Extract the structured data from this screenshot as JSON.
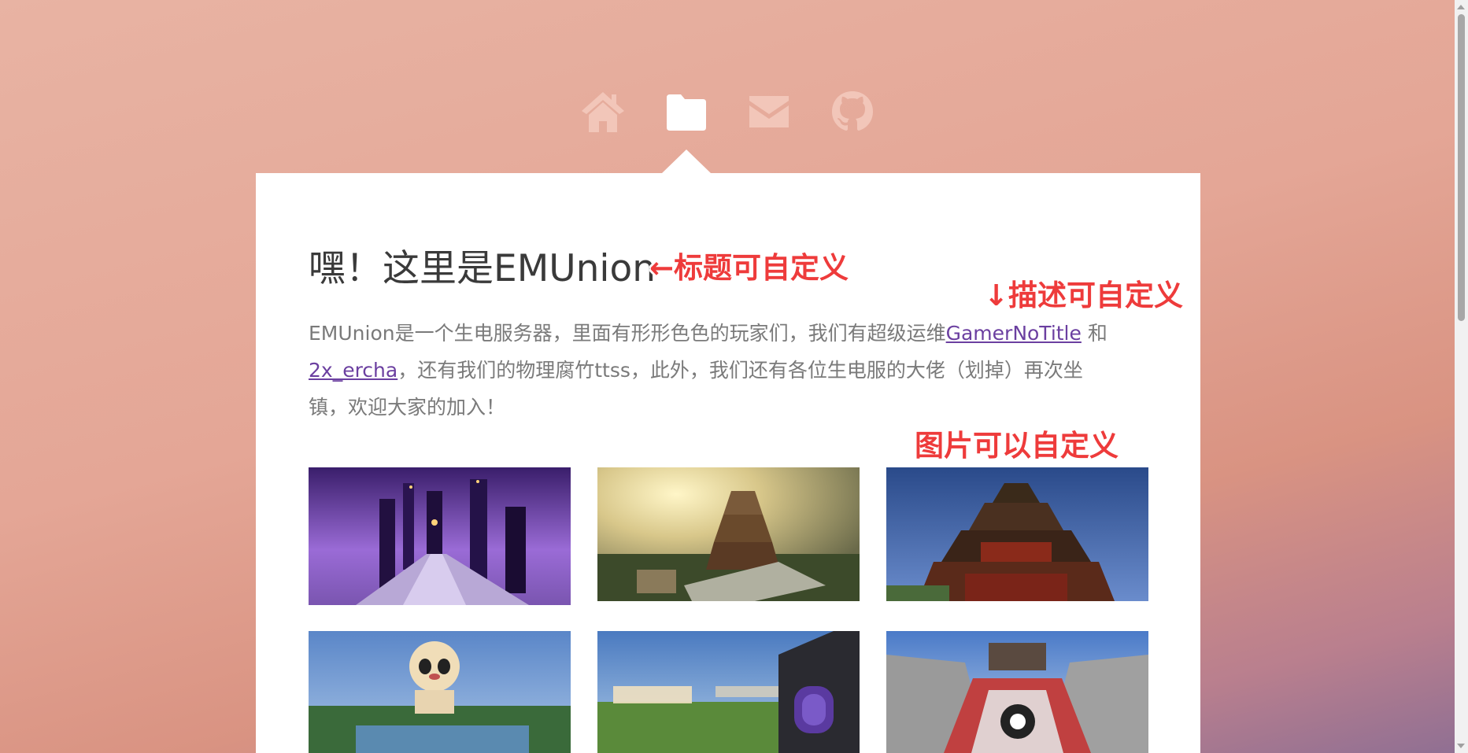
{
  "nav": {
    "items": [
      {
        "icon": "home-icon"
      },
      {
        "icon": "folder-icon",
        "active": true
      },
      {
        "icon": "mail-icon"
      },
      {
        "icon": "github-icon"
      }
    ],
    "icon_color": "#f2c6b9",
    "active_color": "#ffffff"
  },
  "main": {
    "title": "嘿！这里是EMUnion",
    "description": {
      "part1": "EMUnion是一个生电服务器，里面有形形色色的玩家们，我们有超级运维",
      "link1": "GamerNoTitle",
      "part2": " 和 ",
      "link2": "2x_ercha",
      "part3": "，还有我们的物理腐竹ttss，此外，我们还有各位生电服的大佬（划掉）再次坐镇，欢迎大家的加入！"
    },
    "gallery": [
      {
        "scene": "purple-end-bridge"
      },
      {
        "scene": "sunset-pagoda"
      },
      {
        "scene": "blue-sky-pagoda"
      },
      {
        "scene": "panda-statue-harbor"
      },
      {
        "scene": "emunion-sign-portal"
      },
      {
        "scene": "courtyard-arena"
      }
    ]
  },
  "annotations": {
    "title_note": "←标题可自定义",
    "desc_note": "↓描述可自定义",
    "image_note": "图片可以自定义",
    "color": "#ee3b3b"
  }
}
